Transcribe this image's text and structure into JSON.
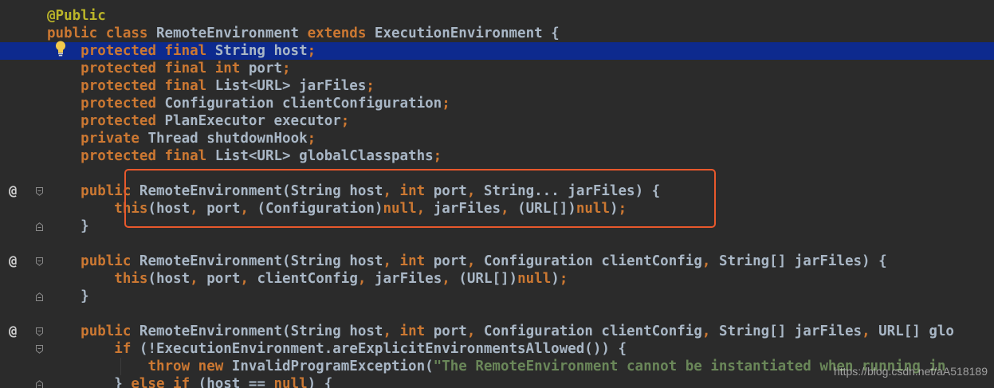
{
  "editor": {
    "lines": [
      {
        "id": "l01",
        "segs": [
          [
            "an",
            "@Public"
          ]
        ]
      },
      {
        "id": "l02",
        "segs": [
          [
            "kw",
            "public class "
          ],
          [
            "pl",
            "RemoteEnvironment "
          ],
          [
            "kw",
            "extends "
          ],
          [
            "pl",
            "ExecutionEnvironment {"
          ]
        ]
      },
      {
        "id": "l03",
        "segs": [
          [
            "pl",
            "    "
          ],
          [
            "kw",
            "protected final "
          ],
          [
            "pl",
            "String host"
          ],
          [
            "kw",
            ";"
          ]
        ]
      },
      {
        "id": "l04",
        "segs": [
          [
            "pl",
            "    "
          ],
          [
            "kw",
            "protected final int "
          ],
          [
            "pl",
            "port"
          ],
          [
            "kw",
            ";"
          ]
        ]
      },
      {
        "id": "l05",
        "segs": [
          [
            "pl",
            "    "
          ],
          [
            "kw",
            "protected final "
          ],
          [
            "pl",
            "List<URL> jarFiles"
          ],
          [
            "kw",
            ";"
          ]
        ]
      },
      {
        "id": "l06",
        "segs": [
          [
            "pl",
            "    "
          ],
          [
            "kw",
            "protected "
          ],
          [
            "pl",
            "Configuration clientConfiguration"
          ],
          [
            "kw",
            ";"
          ]
        ]
      },
      {
        "id": "l07",
        "segs": [
          [
            "pl",
            "    "
          ],
          [
            "kw",
            "protected "
          ],
          [
            "pl",
            "PlanExecutor executor"
          ],
          [
            "kw",
            ";"
          ]
        ]
      },
      {
        "id": "l08",
        "segs": [
          [
            "pl",
            "    "
          ],
          [
            "kw",
            "private "
          ],
          [
            "pl",
            "Thread shutdownHook"
          ],
          [
            "kw",
            ";"
          ]
        ]
      },
      {
        "id": "l09",
        "segs": [
          [
            "pl",
            "    "
          ],
          [
            "kw",
            "protected final "
          ],
          [
            "pl",
            "List<URL> globalClasspaths"
          ],
          [
            "kw",
            ";"
          ]
        ]
      },
      {
        "id": "l10",
        "segs": []
      },
      {
        "id": "l11",
        "segs": [
          [
            "pl",
            "    "
          ],
          [
            "kw",
            "public "
          ],
          [
            "pl",
            "RemoteEnvironment(String host"
          ],
          [
            "kw",
            ", int "
          ],
          [
            "pl",
            "port"
          ],
          [
            "kw",
            ", "
          ],
          [
            "pl",
            "String... jarFiles) {"
          ]
        ]
      },
      {
        "id": "l12",
        "segs": [
          [
            "pl",
            "        "
          ],
          [
            "kw",
            "this"
          ],
          [
            "pl",
            "(host"
          ],
          [
            "kw",
            ", "
          ],
          [
            "pl",
            "port"
          ],
          [
            "kw",
            ", "
          ],
          [
            "pl",
            "(Configuration)"
          ],
          [
            "kw",
            "null, "
          ],
          [
            "pl",
            "jarFiles"
          ],
          [
            "kw",
            ", "
          ],
          [
            "pl",
            "(URL[])"
          ],
          [
            "kw",
            "null"
          ],
          [
            "pl",
            ")"
          ],
          [
            "kw",
            ";"
          ]
        ]
      },
      {
        "id": "l13",
        "segs": [
          [
            "pl",
            "    }"
          ]
        ]
      },
      {
        "id": "l14",
        "segs": []
      },
      {
        "id": "l15",
        "segs": [
          [
            "pl",
            "    "
          ],
          [
            "kw",
            "public "
          ],
          [
            "pl",
            "RemoteEnvironment(String host"
          ],
          [
            "kw",
            ", int "
          ],
          [
            "pl",
            "port"
          ],
          [
            "kw",
            ", "
          ],
          [
            "pl",
            "Configuration clientConfig"
          ],
          [
            "kw",
            ", "
          ],
          [
            "pl",
            "String[] jarFiles) {"
          ]
        ]
      },
      {
        "id": "l16",
        "segs": [
          [
            "pl",
            "        "
          ],
          [
            "kw",
            "this"
          ],
          [
            "pl",
            "(host"
          ],
          [
            "kw",
            ", "
          ],
          [
            "pl",
            "port"
          ],
          [
            "kw",
            ", "
          ],
          [
            "pl",
            "clientConfig"
          ],
          [
            "kw",
            ", "
          ],
          [
            "pl",
            "jarFiles"
          ],
          [
            "kw",
            ", "
          ],
          [
            "pl",
            "(URL[])"
          ],
          [
            "kw",
            "null"
          ],
          [
            "pl",
            ")"
          ],
          [
            "kw",
            ";"
          ]
        ]
      },
      {
        "id": "l17",
        "segs": [
          [
            "pl",
            "    }"
          ]
        ]
      },
      {
        "id": "l18",
        "segs": []
      },
      {
        "id": "l19",
        "segs": [
          [
            "pl",
            "    "
          ],
          [
            "kw",
            "public "
          ],
          [
            "pl",
            "RemoteEnvironment(String host"
          ],
          [
            "kw",
            ", int "
          ],
          [
            "pl",
            "port"
          ],
          [
            "kw",
            ", "
          ],
          [
            "pl",
            "Configuration clientConfig"
          ],
          [
            "kw",
            ", "
          ],
          [
            "pl",
            "String[] jarFiles"
          ],
          [
            "kw",
            ", "
          ],
          [
            "pl",
            "URL[] glo"
          ]
        ]
      },
      {
        "id": "l20",
        "segs": [
          [
            "pl",
            "        "
          ],
          [
            "kw",
            "if "
          ],
          [
            "pl",
            "(!ExecutionEnvironment.areExplicitEnvironmentsAllowed()) {"
          ]
        ]
      },
      {
        "id": "l21",
        "segs": [
          [
            "pl",
            "            "
          ],
          [
            "kw",
            "throw new "
          ],
          [
            "pl",
            "InvalidProgramException("
          ],
          [
            "st",
            "\"The RemoteEnvironment cannot be instantiated when running in "
          ]
        ]
      },
      {
        "id": "l22",
        "segs": [
          [
            "pl",
            "        } "
          ],
          [
            "kw",
            "else if "
          ],
          [
            "pl",
            "(host == "
          ],
          [
            "kw",
            "null"
          ],
          [
            "pl",
            ") {"
          ]
        ]
      }
    ],
    "gutter_at_lines": [
      11,
      15,
      19
    ],
    "highlighted_line": 3
  },
  "watermark": "https://blog.csdn.net/aA518189",
  "colors": {
    "background": "#2b2b2b",
    "keyword": "#cc7832",
    "plain": "#a9b7c6",
    "string": "#6a8759",
    "annotation": "#bbb529",
    "current_line": "#0d2a8e",
    "callout_border": "#e8582c"
  }
}
